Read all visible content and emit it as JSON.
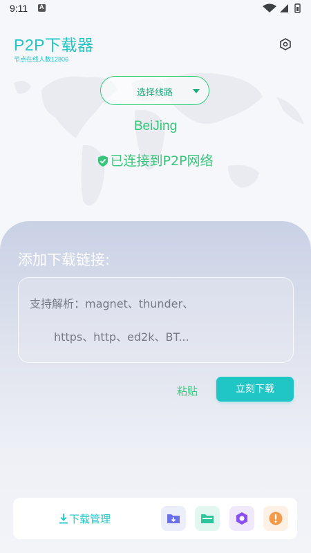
{
  "status_bar": {
    "time": "9:11"
  },
  "header": {
    "title": "P2P下载器",
    "node_count": "节点在线人数12806"
  },
  "route_selector": {
    "label": "选择线路"
  },
  "location": "BeiJing",
  "connection_status": "已连接到P2P网络",
  "download_panel": {
    "title": "添加下载链接:",
    "input_line1": "支持解析：magnet、thunder、",
    "input_line2": "https、http、ed2k、BT...",
    "paste_label": "粘贴",
    "download_label": "立刻下载"
  },
  "bottom_bar": {
    "manage_label": "下载管理",
    "icons": [
      "folder-download-icon",
      "folder-icon",
      "hexagon-app-icon",
      "alert-icon"
    ]
  },
  "colors": {
    "accent": "#1fc6c5",
    "green": "#37c67b"
  }
}
